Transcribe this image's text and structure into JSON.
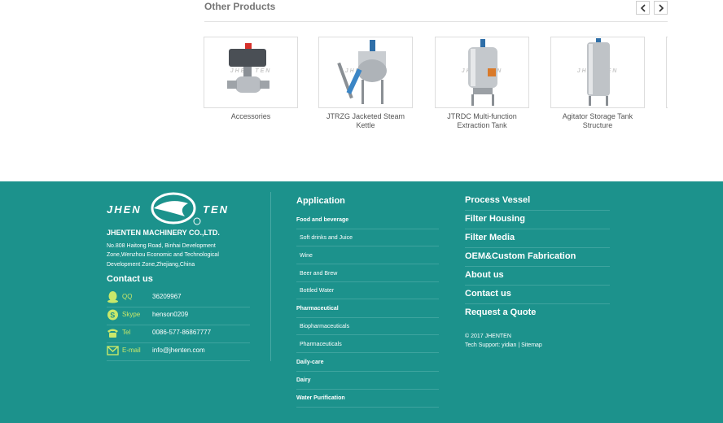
{
  "other_products": {
    "title": "Other Products",
    "items": [
      {
        "caption": "Accessories",
        "watermark": "JHEN TEN"
      },
      {
        "caption": "JTRZG Jacketed Steam Kettle",
        "watermark": "JHEN TEN"
      },
      {
        "caption": "JTRDC Multi-function Extraction Tank",
        "watermark": "JHEN TEN"
      },
      {
        "caption": "Agitator Storage Tank Structure",
        "watermark": "JHEN TEN"
      }
    ]
  },
  "footer": {
    "logo_left": "JHEN",
    "logo_right": "TEN",
    "company": "JHENTEN MACHINERY CO.,LTD.",
    "address": "No.808 Haitong Road, Binhai Development Zone,Wenzhou Economic and Technological Development Zone,Zhejiang,China",
    "contact_title": "Contact us",
    "contacts": [
      {
        "label": "QQ",
        "value": "36209967",
        "icon": "qq-icon"
      },
      {
        "label": "Skype",
        "value": "henson0209",
        "icon": "skype-icon"
      },
      {
        "label": "Tel",
        "value": "0086-577-86867777",
        "icon": "phone-icon"
      },
      {
        "label": "E-mail",
        "value": "info@jhenten.com",
        "icon": "mail-icon"
      }
    ],
    "application_title": "Application",
    "application_items": [
      {
        "label": "Food and beverage",
        "type": "cat"
      },
      {
        "label": "Soft drinks and Juice",
        "type": "sub"
      },
      {
        "label": "Wine",
        "type": "sub"
      },
      {
        "label": "Beer and Brew",
        "type": "sub"
      },
      {
        "label": "Bottled Water",
        "type": "sub"
      },
      {
        "label": "Pharmaceutical",
        "type": "cat"
      },
      {
        "label": "Biopharmaceuticals",
        "type": "sub"
      },
      {
        "label": "Pharmaceuticals",
        "type": "sub"
      },
      {
        "label": "Daily-care",
        "type": "cat"
      },
      {
        "label": "Dairy",
        "type": "cat"
      },
      {
        "label": "Water Purification",
        "type": "cat"
      }
    ],
    "menu": [
      "Process Vessel",
      "Filter Housing",
      "Filter Media",
      "OEM&Custom Fabrication",
      "About us",
      "Contact us",
      "Request a Quote"
    ],
    "copyright": "© 2017 JHENTEN",
    "tech_support": "Tech Support: yidian | Sitemap"
  },
  "colors": {
    "footer_bg": "#1c928c",
    "accent_label": "#c9e86a"
  }
}
